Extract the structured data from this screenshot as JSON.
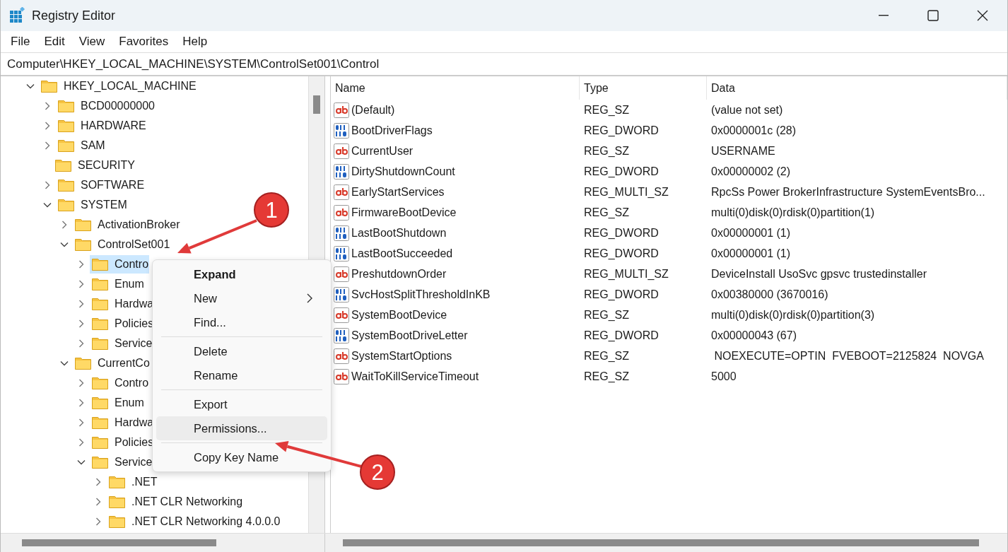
{
  "window": {
    "title": "Registry Editor"
  },
  "menu_bar": [
    "File",
    "Edit",
    "View",
    "Favorites",
    "Help"
  ],
  "address_bar": {
    "value": "Computer\\HKEY_LOCAL_MACHINE\\SYSTEM\\ControlSet001\\Control"
  },
  "tree": [
    {
      "label": "HKEY_LOCAL_MACHINE",
      "expandable": true,
      "expanded": true,
      "selected": false,
      "children": [
        {
          "label": "BCD00000000",
          "expandable": true,
          "expanded": false,
          "selected": false
        },
        {
          "label": "HARDWARE",
          "expandable": true,
          "expanded": false,
          "selected": false
        },
        {
          "label": "SAM",
          "expandable": true,
          "expanded": false,
          "selected": false
        },
        {
          "label": "SECURITY",
          "expandable": false,
          "expanded": false,
          "selected": false
        },
        {
          "label": "SOFTWARE",
          "expandable": true,
          "expanded": false,
          "selected": false
        },
        {
          "label": "SYSTEM",
          "expandable": true,
          "expanded": true,
          "selected": false,
          "children": [
            {
              "label": "ActivationBroker",
              "expandable": true,
              "expanded": false,
              "selected": false
            },
            {
              "label": "ControlSet001",
              "expandable": true,
              "expanded": true,
              "selected": false,
              "children": [
                {
                  "label": "Contro",
                  "expandable": true,
                  "expanded": false,
                  "selected": true
                },
                {
                  "label": "Enum",
                  "expandable": true,
                  "expanded": false,
                  "selected": false
                },
                {
                  "label": "Hardwa",
                  "expandable": true,
                  "expanded": false,
                  "selected": false
                },
                {
                  "label": "Policies",
                  "expandable": true,
                  "expanded": false,
                  "selected": false
                },
                {
                  "label": "Service",
                  "expandable": true,
                  "expanded": false,
                  "selected": false
                }
              ]
            },
            {
              "label": "CurrentCo",
              "expandable": true,
              "expanded": true,
              "selected": false,
              "children": [
                {
                  "label": "Contro",
                  "expandable": true,
                  "expanded": false,
                  "selected": false
                },
                {
                  "label": "Enum",
                  "expandable": true,
                  "expanded": false,
                  "selected": false
                },
                {
                  "label": "Hardwa",
                  "expandable": true,
                  "expanded": false,
                  "selected": false
                },
                {
                  "label": "Policies",
                  "expandable": true,
                  "expanded": false,
                  "selected": false
                },
                {
                  "label": "Service",
                  "expandable": true,
                  "expanded": true,
                  "selected": false,
                  "children": [
                    {
                      "label": ".NET",
                      "expandable": true,
                      "expanded": false,
                      "selected": false
                    },
                    {
                      "label": ".NET CLR Networking",
                      "expandable": true,
                      "expanded": false,
                      "selected": false
                    },
                    {
                      "label": ".NET CLR Networking 4.0.0.0",
                      "expandable": true,
                      "expanded": false,
                      "selected": false
                    }
                  ]
                }
              ]
            }
          ]
        }
      ]
    }
  ],
  "values": {
    "columns": [
      "Name",
      "Type",
      "Data"
    ],
    "rows": [
      {
        "kind": "string",
        "name": "(Default)",
        "type": "REG_SZ",
        "data": "(value not set)"
      },
      {
        "kind": "binary",
        "name": "BootDriverFlags",
        "type": "REG_DWORD",
        "data": "0x0000001c (28)"
      },
      {
        "kind": "string",
        "name": "CurrentUser",
        "type": "REG_SZ",
        "data": "USERNAME"
      },
      {
        "kind": "binary",
        "name": "DirtyShutdownCount",
        "type": "REG_DWORD",
        "data": "0x00000002 (2)"
      },
      {
        "kind": "string",
        "name": "EarlyStartServices",
        "type": "REG_MULTI_SZ",
        "data": "RpcSs Power BrokerInfrastructure SystemEventsBro..."
      },
      {
        "kind": "string",
        "name": "FirmwareBootDevice",
        "type": "REG_SZ",
        "data": "multi(0)disk(0)rdisk(0)partition(1)"
      },
      {
        "kind": "binary",
        "name": "LastBootShutdown",
        "type": "REG_DWORD",
        "data": "0x00000001 (1)"
      },
      {
        "kind": "binary",
        "name": "LastBootSucceeded",
        "type": "REG_DWORD",
        "data": "0x00000001 (1)"
      },
      {
        "kind": "string",
        "name": "PreshutdownOrder",
        "type": "REG_MULTI_SZ",
        "data": "DeviceInstall UsoSvc gpsvc trustedinstaller"
      },
      {
        "kind": "binary",
        "name": "SvcHostSplitThresholdInKB",
        "type": "REG_DWORD",
        "data": "0x00380000 (3670016)"
      },
      {
        "kind": "string",
        "name": "SystemBootDevice",
        "type": "REG_SZ",
        "data": "multi(0)disk(0)rdisk(0)partition(3)"
      },
      {
        "kind": "binary",
        "name": "SystemBootDriveLetter",
        "type": "REG_DWORD",
        "data": "0x00000043 (67)"
      },
      {
        "kind": "string",
        "name": "SystemStartOptions",
        "type": "REG_SZ",
        "data": " NOEXECUTE=OPTIN  FVEBOOT=2125824  NOVGA"
      },
      {
        "kind": "string",
        "name": "WaitToKillServiceTimeout",
        "type": "REG_SZ",
        "data": "5000"
      }
    ]
  },
  "context_menu": {
    "groups": [
      [
        {
          "label": "Expand",
          "bold": true,
          "submenu": false,
          "selected": false
        },
        {
          "label": "New",
          "bold": false,
          "submenu": true,
          "selected": false
        },
        {
          "label": "Find...",
          "bold": false,
          "submenu": false,
          "selected": false
        }
      ],
      [
        {
          "label": "Delete",
          "bold": false,
          "submenu": false,
          "selected": false
        },
        {
          "label": "Rename",
          "bold": false,
          "submenu": false,
          "selected": false
        }
      ],
      [
        {
          "label": "Export",
          "bold": false,
          "submenu": false,
          "selected": false
        },
        {
          "label": "Permissions...",
          "bold": false,
          "submenu": false,
          "selected": true
        }
      ],
      [
        {
          "label": "Copy Key Name",
          "bold": false,
          "submenu": false,
          "selected": false
        }
      ]
    ]
  },
  "annotations": [
    {
      "label": "1"
    },
    {
      "label": "2"
    }
  ]
}
